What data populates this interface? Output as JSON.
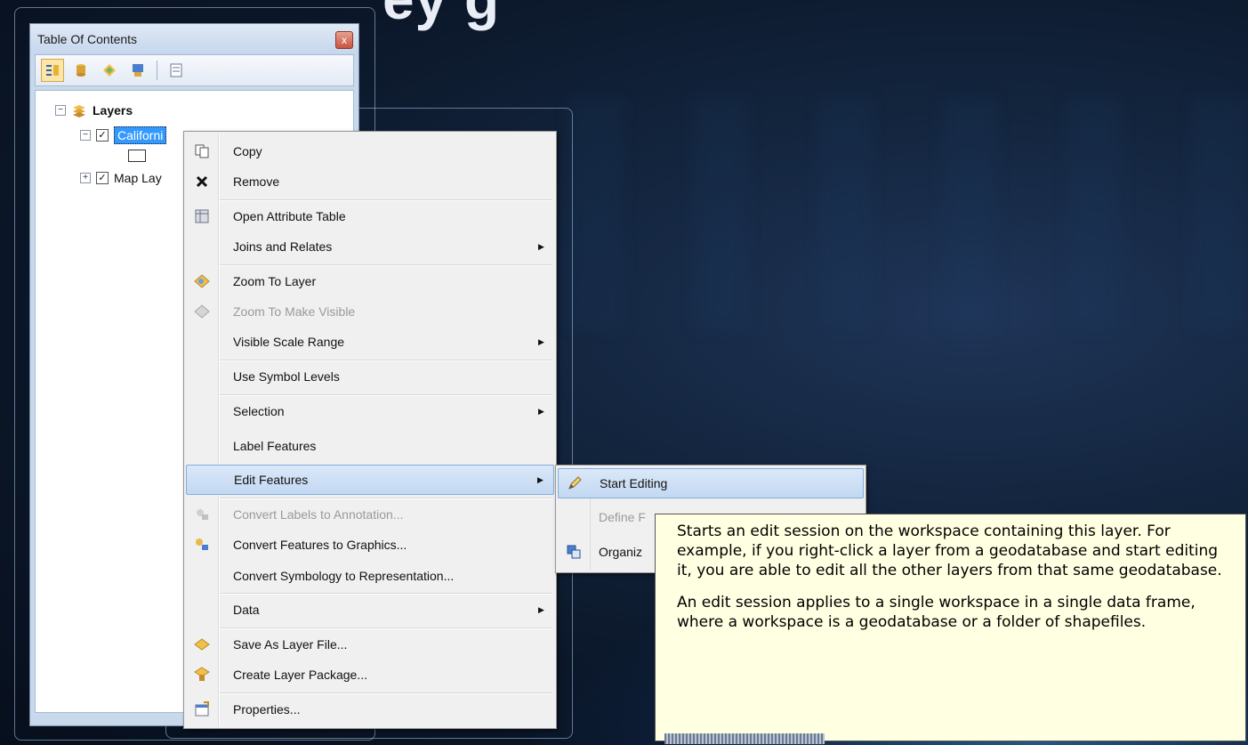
{
  "slide": {
    "title_fragment": "ey        g"
  },
  "toc": {
    "title": "Table Of Contents",
    "close_glyph": "x",
    "toolbar": [
      "list-by-drawing-order-icon",
      "list-by-source-icon",
      "list-by-visibility-icon",
      "list-by-selection-icon",
      "options-icon"
    ],
    "tree": {
      "root": "Layers",
      "selected_layer": "California Counties",
      "selected_layer_visible_part": "Californi",
      "other_layer": "Map Lay"
    }
  },
  "menu": {
    "items": {
      "copy": "Copy",
      "remove": "Remove",
      "open_attribute_table": "Open Attribute Table",
      "joins_and_relates": "Joins and Relates",
      "zoom_to_layer": "Zoom To Layer",
      "zoom_to_make_visible": "Zoom To Make Visible",
      "visible_scale_range": "Visible Scale Range",
      "use_symbol_levels": "Use Symbol Levels",
      "selection": "Selection",
      "label_features": "Label Features",
      "edit_features": "Edit Features",
      "convert_labels": "Convert Labels to Annotation...",
      "convert_features": "Convert Features to Graphics...",
      "convert_symbology": "Convert Symbology to Representation...",
      "data": "Data",
      "save_as_layer_file": "Save As Layer File...",
      "create_layer_package": "Create Layer Package...",
      "properties": "Properties..."
    },
    "submenu_arrow": "▶"
  },
  "submenu": {
    "start_editing": "Start Editing",
    "define_partial": "Define F",
    "organize_partial": "Organiz"
  },
  "tooltip": {
    "p1": "Starts an edit session on the workspace containing this layer. For example, if you right-click a layer from a geodatabase and start editing it, you are able to edit all the other layers from that same geodatabase.",
    "p2": "An edit session applies to a single workspace in a single data frame, where a workspace is a geodatabase or a folder of shapefiles."
  },
  "colors": {
    "highlight": "#c2d8f2",
    "tooltip_bg": "#ffffe1",
    "selection_blue": "#3399ff"
  }
}
